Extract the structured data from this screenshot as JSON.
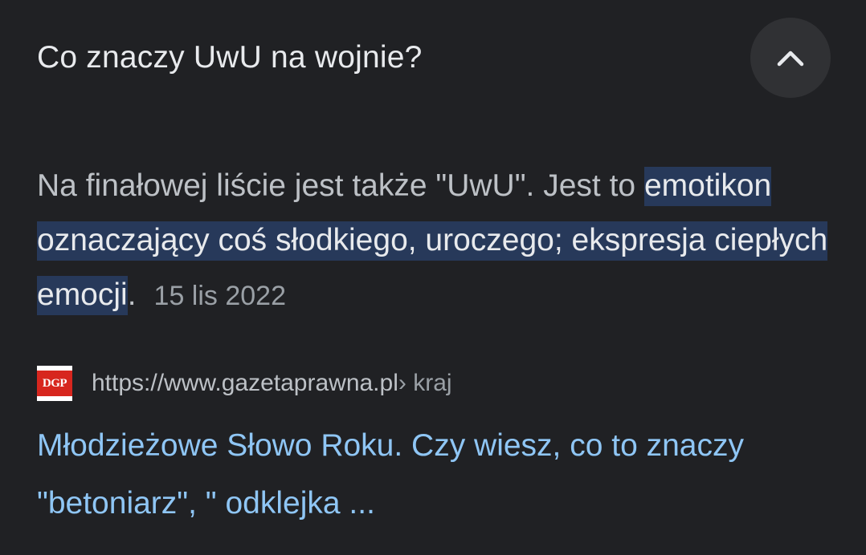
{
  "question": {
    "title": "Co znaczy UwU na wojnie?",
    "collapse_icon": "chevron-up-icon"
  },
  "answer": {
    "intro": "Na finałowej liście jest także \"UwU\". Jest to ",
    "highlight": "emotikon oznaczający coś słodkiego, uroczego; ekspresja ciepłych emocji",
    "end": ".",
    "date": "15 lis 2022"
  },
  "source": {
    "favicon_text": "DGP",
    "url": "https://www.gazetaprawna.pl",
    "path": " › kraj"
  },
  "result": {
    "title": "Młodzieżowe Słowo Roku. Czy wiesz, co to znaczy \"betoniarz\", \" odklejka ..."
  },
  "colors": {
    "background": "#202124",
    "highlight": "#27395a",
    "link": "#8fc6f5",
    "favicon_red": "#d7261e"
  }
}
